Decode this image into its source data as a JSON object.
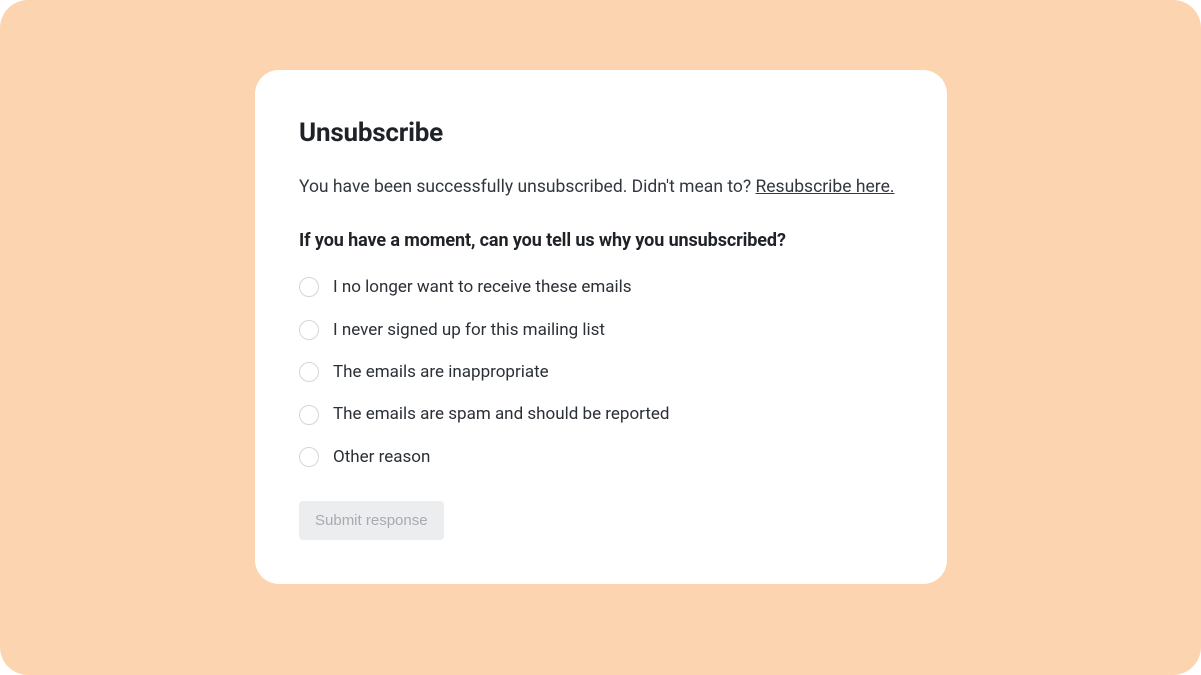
{
  "card": {
    "title": "Unsubscribe",
    "message_prefix": "You have been successfully unsubscribed. Didn't mean to? ",
    "resubscribe_link": "Resubscribe here.",
    "prompt": "If you have a moment, can you tell us why you unsubscribed?",
    "options": [
      "I no longer want to receive these emails",
      "I never signed up for this mailing list",
      "The emails are inappropriate",
      "The emails are spam and should be reported",
      "Other reason"
    ],
    "submit_label": "Submit response"
  }
}
